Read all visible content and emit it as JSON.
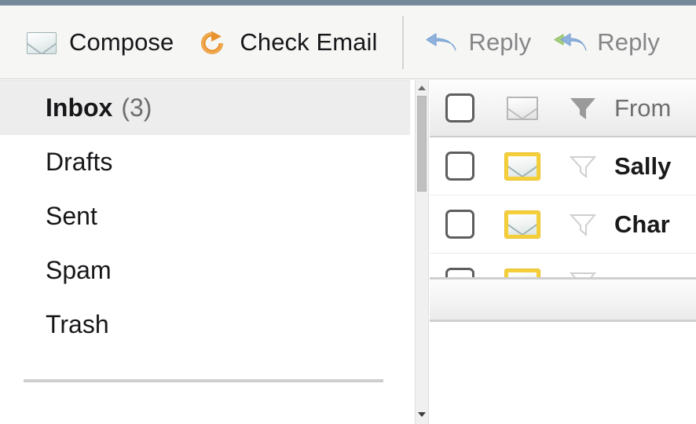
{
  "window": {
    "chrome_color": "#76899a"
  },
  "toolbar": {
    "buttons": [
      {
        "label": "Compose",
        "icon": "envelope-icon",
        "enabled": true
      },
      {
        "label": "Check Email",
        "icon": "refresh-icon",
        "enabled": true
      },
      {
        "label": "Reply",
        "icon": "reply-arrow-icon",
        "enabled": false
      },
      {
        "label": "Reply",
        "icon": "reply-all-arrow-icon",
        "enabled": false
      }
    ]
  },
  "sidebar": {
    "folders": [
      {
        "label": "Inbox",
        "count": "(3)",
        "selected": true
      },
      {
        "label": "Drafts",
        "count": "",
        "selected": false
      },
      {
        "label": "Sent",
        "count": "",
        "selected": false
      },
      {
        "label": "Spam",
        "count": "",
        "selected": false
      },
      {
        "label": "Trash",
        "count": "",
        "selected": false
      }
    ]
  },
  "scrollbar": {
    "up_arrow": "scroll-up-icon",
    "down_arrow": "scroll-down-icon"
  },
  "message_list": {
    "columns": {
      "select_all": "select-all-checkbox",
      "read_status": "envelope-icon",
      "flag": "filter-funnel-icon",
      "from": "From"
    },
    "rows": [
      {
        "from": "Sally",
        "unread": true,
        "checked": false,
        "flagged": false
      },
      {
        "from": "Char",
        "unread": true,
        "checked": false,
        "flagged": false
      },
      {
        "from": "",
        "unread": true,
        "checked": false,
        "flagged": false
      }
    ]
  },
  "colors": {
    "unread_envelope_border": "#f5cf3a",
    "refresh_icon": "#e8922e",
    "reply_arrow": "#8fb3dd",
    "reply_all_arrow": "#a4cf7c",
    "selected_folder_bg": "#ededed"
  }
}
